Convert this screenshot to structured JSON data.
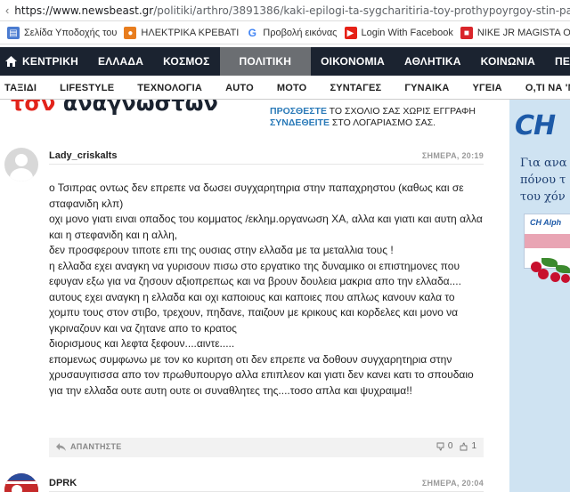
{
  "browser": {
    "url_domain": "https://www.newsbeast.gr",
    "url_path": "/politiki/arthro/3891386/kaki-epilogi-ta-sygcharitiria-toy-prothypoyrgoy-stin-papachristoy"
  },
  "bookmarks": [
    {
      "label": "Σελίδα Υποδοχής του",
      "icon": "page-icon",
      "color": "#4a7bd0"
    },
    {
      "label": "ΗΛΕΚΤΡΙΚΑ ΚΡΕΒΑΤΙ",
      "icon": "shop-icon",
      "color": "#e87d1e"
    },
    {
      "label": "Προβολή εικόνας",
      "icon": "google-icon",
      "color": "#4285f4"
    },
    {
      "label": "Login With Facebook",
      "icon": "youtube-icon",
      "color": "#e62117"
    },
    {
      "label": "NIKE JR MAGISTA ON",
      "icon": "bookmark-icon",
      "color": "#d9252a"
    }
  ],
  "main_nav": {
    "items": [
      "ΚΕΝΤΡΙΚΗ",
      "ΕΛΛΑΔΑ",
      "ΚΟΣΜΟΣ",
      "ΠΟΛΙΤΙΚΗ",
      "ΟΙΚΟΝΟΜΙΑ",
      "ΑΘΛΗΤΙΚΑ",
      "ΚΟΙΝΩΝΙΑ",
      "ΠΕΡΙΒΑΛΛΟΝ"
    ],
    "active": "ΠΟΛΙΤΙΚΗ"
  },
  "sub_nav": {
    "items": [
      "ΤΑΞΙΔΙ",
      "LIFESTYLE",
      "ΤΕΧΝΟΛΟΓΙΑ",
      "AUTO",
      "ΜΟΤΟ",
      "ΣΥΝΤΑΓΕΣ",
      "ΓΥΝΑΙΚΑ",
      "ΥΓΕΙΑ",
      "Ο,ΤΙ ΝΑ 'ΝΑΙ"
    ]
  },
  "promo": {
    "title_red": "τσν",
    "title_dark": "αναγνωστων",
    "line1_link": "ΠΡΟΣΘΕΣΤΕ",
    "line1_text": " ΤΟ ΣΧΟΛΙΟ ΣΑΣ ΧΩΡΙΣ ΕΓΓΡΑΦΗ",
    "line2_link": "ΣΥΝΔΕΘΕΙΤΕ",
    "line2_text": " ΣΤΟ ΛΟΓΑΡΙΑΣΜΟ ΣΑΣ."
  },
  "comments": [
    {
      "user": "Lady_criskalts",
      "date": "ΣΗΜΕΡΑ, 20:19",
      "paragraphs": [
        "ο Τσιπρας οντως δεν επρεπε να δωσει συγχαρητηρια στην παπαχρηστου (καθως και σε σταφανιδη κλπ)",
        "οχι μονο γιατι ειναι οπαδος του κομματος /εκλημ.οργανωση ΧΑ, αλλα και γιατι και αυτη αλλα και η στεφανιδη και η αλλη,",
        "δεν προσφερουν τιποτε επι της ουσιας στην ελλαδα με τα μεταλλια τους !",
        "η ελλαδα εχει αναγκη να γυρισουν πισω στο εργατικο της δυναμικο οι επιστημονες που εφυγαν εξω για να ζησουν αξιοπρεπως και να βρουν δουλεια μακρια απο την ελλαδα....",
        "αυτους εχει αναγκη η ελλαδα και οχι καποιους και καποιες που απλως κανουν καλα το χομπυ τους στον στιβο, τρεχουν, πηδανε, παιζουν με κρικους και κορδελες και μονο να γκριναζουν και να ζητανε απο το κρατος",
        "διορισμους και λεφτα ξεφουν....αιντε.....",
        "επομενως συμφωνω με τον κο κυριτση οτι δεν επρεπε να δοθουν συγχαρητηρια στην χρυσαυγιτισσα απο τον πρωθυπουργο αλλα επιπλεον και γιατι δεν κανει κατι το σπουδαιο για την ελλαδα ουτε αυτη ουτε οι συναθλητες της....τοσο απλα και ψυχραιμα!!"
      ],
      "reply_label": "ΑΠΑΝΤΗΣΤΕ",
      "dislikes": "0",
      "likes": "1"
    },
    {
      "user": "DPRK",
      "date": "ΣΗΜΕΡΑ, 20:04"
    }
  ],
  "ad": {
    "logo": "CH",
    "lines": [
      "Για ανα",
      "πόνου τ",
      "του χόν"
    ],
    "box_brand": "CH Alph"
  }
}
